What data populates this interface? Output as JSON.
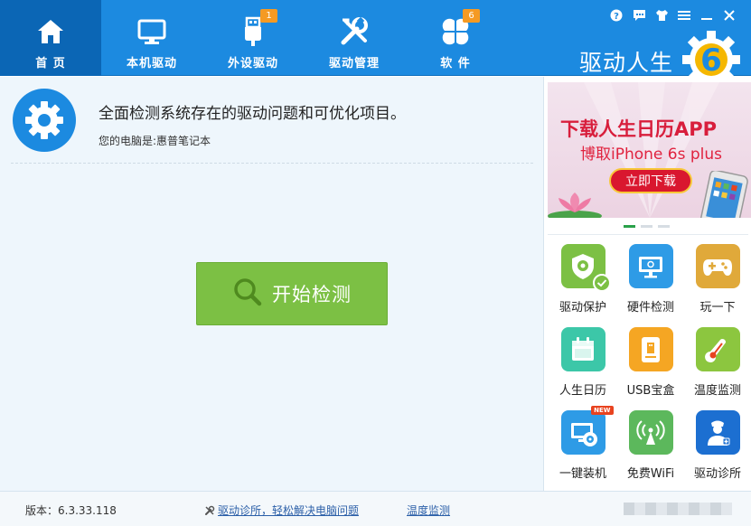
{
  "nav": {
    "items": [
      {
        "label": "首 页",
        "icon": "home-icon",
        "active": true
      },
      {
        "label": "本机驱动",
        "icon": "monitor-icon"
      },
      {
        "label": "外设驱动",
        "icon": "usb-icon",
        "badge": "1"
      },
      {
        "label": "驱动管理",
        "icon": "tools-icon"
      },
      {
        "label": "软 件",
        "icon": "clover-icon",
        "badge": "6"
      }
    ]
  },
  "brand": {
    "name": "驱动人生",
    "logo_digit": "6"
  },
  "main": {
    "headline": "全面检测系统存在的驱动问题和可优化项目。",
    "pc_label": "您的电脑是:",
    "pc_name": "惠普笔记本",
    "scan_button": "开始检测"
  },
  "banner": {
    "title": "下载人生日历APP",
    "subtitle": "博取iPhone 6s plus",
    "button": "立即下载"
  },
  "tools": [
    {
      "label": "驱动保护",
      "icon": "shield-gear-icon",
      "color": "#7cc044"
    },
    {
      "label": "硬件检测",
      "icon": "monitor-check-icon",
      "color": "#2e9be6"
    },
    {
      "label": "玩一下",
      "icon": "gamepad-icon",
      "color": "#e0a93a"
    },
    {
      "label": "人生日历",
      "icon": "calendar-icon",
      "color": "#3cc7a8"
    },
    {
      "label": "USB宝盒",
      "icon": "usb-box-icon",
      "color": "#f5a623"
    },
    {
      "label": "温度监测",
      "icon": "thermometer-icon",
      "color": "#8cc63f"
    },
    {
      "label": "一键装机",
      "icon": "install-disc-icon",
      "color": "#2e9be6",
      "tag": "NEW"
    },
    {
      "label": "免费WiFi",
      "icon": "wifi-icon",
      "color": "#5cb85c"
    },
    {
      "label": "驱动诊所",
      "icon": "doctor-icon",
      "color": "#1c6fd1"
    }
  ],
  "status": {
    "version": "版本：6.3.33.118",
    "diag_link": "驱动诊所，轻松解决电脑问题",
    "temp_link": "温度监测"
  },
  "colors": {
    "primary": "#1c8ae0",
    "active_tab": "#0b66b5",
    "scan": "#7cc044",
    "main_bg": "#eef6fc"
  }
}
